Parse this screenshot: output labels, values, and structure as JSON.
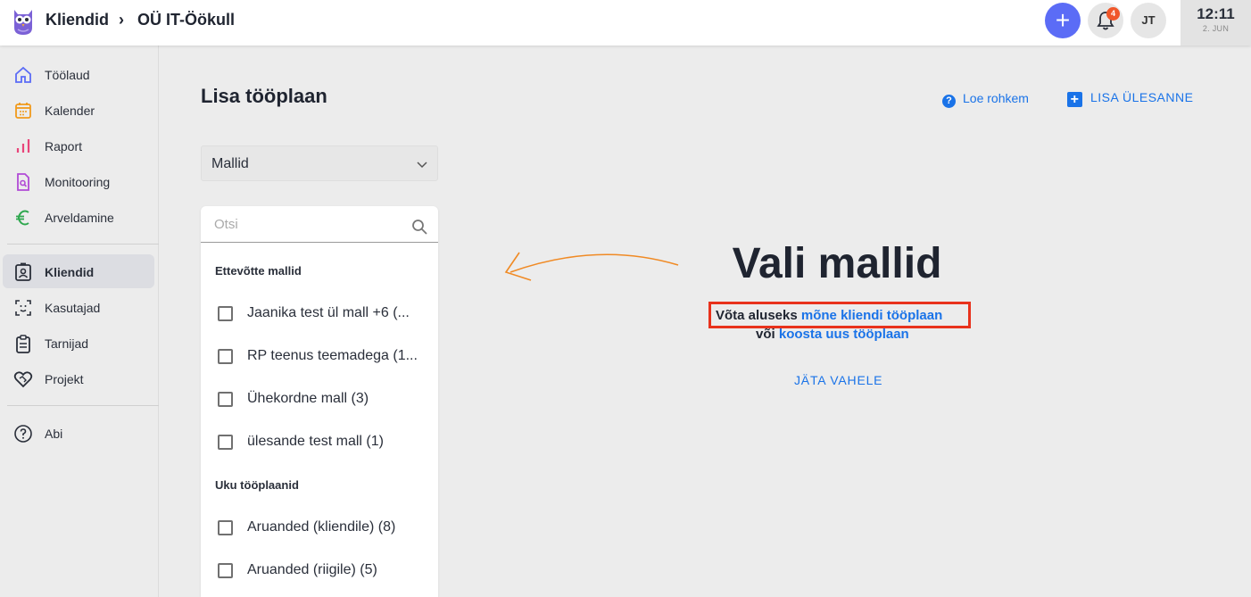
{
  "topbar": {
    "breadcrumb": [
      "Kliendid",
      "›",
      "OÜ IT-Öökull"
    ],
    "notification_count": "4",
    "user_initials": "JT",
    "clock_time": "12:11",
    "clock_date": "2. JUN",
    "accent_color": "#5b6cf6"
  },
  "sidebar": {
    "items": [
      {
        "label": "Töölaud",
        "icon": "home-icon"
      },
      {
        "label": "Kalender",
        "icon": "calendar-icon"
      },
      {
        "label": "Raport",
        "icon": "bar-chart-icon"
      },
      {
        "label": "Monitooring",
        "icon": "document-search-icon"
      },
      {
        "label": "Arveldamine",
        "icon": "euro-icon"
      },
      {
        "label": "Kliendid",
        "icon": "contact-card-icon",
        "active": true
      },
      {
        "label": "Kasutajad",
        "icon": "face-scan-icon"
      },
      {
        "label": "Tarnijad",
        "icon": "clipboard-icon"
      },
      {
        "label": "Projekt",
        "icon": "handshake-heart-icon"
      },
      {
        "label": "Abi",
        "icon": "help-circle-icon"
      }
    ]
  },
  "main": {
    "title": "Lisa tööplaan",
    "help_link": "Loe rohkem",
    "add_task": "LISA ÜLESANNE",
    "select_value": "Mallid",
    "search_placeholder": "Otsi",
    "groups": [
      {
        "title": "Ettevõtte mallid",
        "options": [
          "Jaanika test ül mall +6 (...",
          "RP teenus teemadega (1...",
          "Ühekordne mall (3)",
          "ülesande test mall (1)"
        ]
      },
      {
        "title": "Uku tööplaanid",
        "options": [
          "Aruanded (kliendile) (8)",
          "Aruanded (riigile) (5)"
        ]
      }
    ]
  },
  "hero": {
    "title": "Vali mallid",
    "line1_prefix": "Võta aluseks",
    "line1_link": "mõne kliendi tööplaan",
    "line2_prefix": "või",
    "line2_link": "koosta uus tööplaan",
    "skip": "JÄTA VAHELE",
    "highlight_color": "#e8321c",
    "arrow_color": "#f08a24"
  }
}
